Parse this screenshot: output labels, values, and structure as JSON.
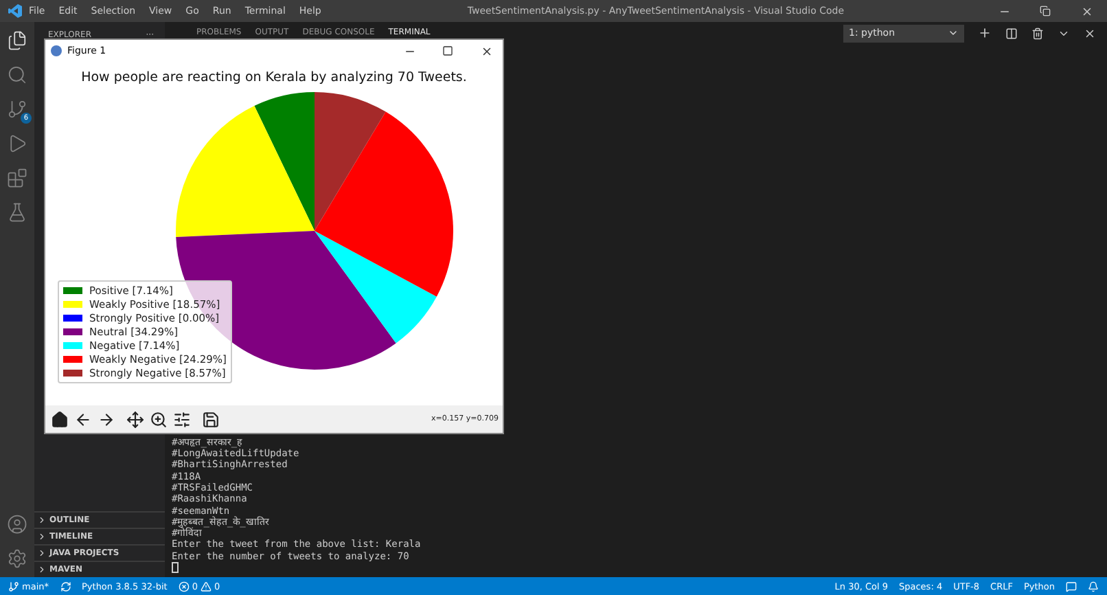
{
  "window": {
    "title": "TweetSentimentAnalysis.py - AnyTweetSentimentAnalysis - Visual Studio Code",
    "menu": [
      "File",
      "Edit",
      "Selection",
      "View",
      "Go",
      "Run",
      "Terminal",
      "Help"
    ]
  },
  "activity_bar": {
    "badge": "6"
  },
  "sidebar": {
    "title": "EXPLORER",
    "more": "···",
    "sections": [
      {
        "label": "OUTLINE",
        "expanded": false
      },
      {
        "label": "TIMELINE",
        "expanded": false
      },
      {
        "label": "JAVA PROJECTS",
        "expanded": false
      },
      {
        "label": "MAVEN",
        "expanded": false
      }
    ]
  },
  "panel": {
    "tabs": [
      {
        "label": "PROBLEMS",
        "selected": false
      },
      {
        "label": "OUTPUT",
        "selected": false
      },
      {
        "label": "DEBUG CONSOLE",
        "selected": false
      },
      {
        "label": "TERMINAL",
        "selected": true
      }
    ],
    "terminal_select": "1: python",
    "lines": [
      "#अपहृत_सरकार_ह",
      "#LongAwaitedLiftUpdate",
      "#BhartiSinghArrested",
      "#118A",
      "#TRSFailedGHMC",
      "#RaashiKhanna",
      "#seemanWtn",
      "#मुहब्बत_सेहत_के_खातिर",
      "#गोविंदा",
      "Enter the tweet from the above list: Kerala",
      "Enter the number of tweets to analyze: 70"
    ]
  },
  "figure": {
    "title": "Figure 1",
    "coords": "x=0.157 y=0.709",
    "legend": [
      {
        "percent": "[7.14%]",
        "color": "#008000"
      },
      {
        "percent": "[18.57%]",
        "color": "#ffff00"
      },
      {
        "percent": "[0.00%]",
        "color": "#0000ff"
      },
      {
        "percent": "[34.29%]",
        "color": "#800080"
      },
      {
        "percent": "[7.14%]",
        "color": "#00ffff"
      },
      {
        "percent": "[24.29%]",
        "color": "#ff0000"
      },
      {
        "percent": "[8.57%]",
        "color": "#a52a2a"
      }
    ],
    "chart_data": {
      "type": "pie",
      "title": "How people are reacting on Kerala by analyzing 70 Tweets.",
      "categories": [
        "Positive",
        "Weakly Positive",
        "Strongly Positive",
        "Neutral",
        "Negative",
        "Weakly Negative",
        "Strongly Negative"
      ],
      "values": [
        7.14,
        18.57,
        0.0,
        34.29,
        7.14,
        24.29,
        8.57
      ]
    }
  },
  "status_bar": {
    "branch": "main*",
    "interpreter": "Python 3.8.5 32-bit",
    "errors": "0",
    "warnings": "0",
    "position": "Ln 30, Col 9",
    "spaces": "Spaces: 4",
    "encoding": "UTF-8",
    "eol": "CRLF",
    "language": "Python"
  }
}
